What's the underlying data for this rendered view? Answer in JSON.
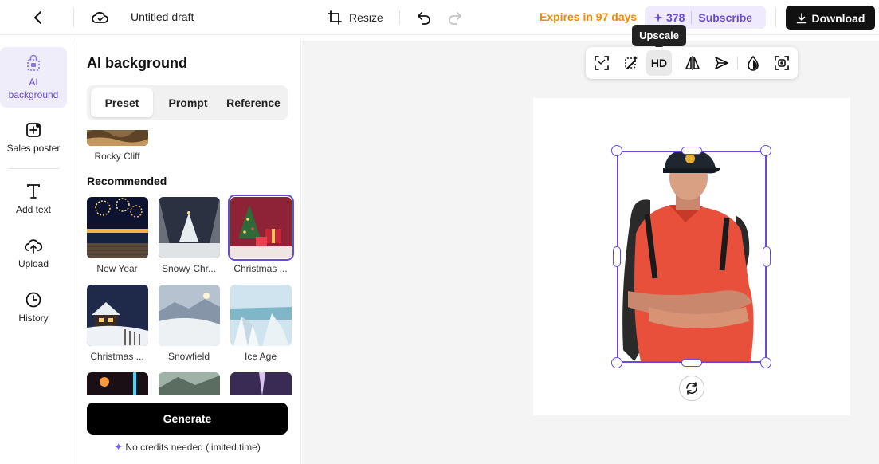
{
  "header": {
    "back_icon": "chevron-left-icon",
    "cloud_icon": "cloud-sync-icon",
    "title": "Untitled draft",
    "resize_label": "Resize",
    "undo_icon": "undo-icon",
    "redo_icon": "redo-icon",
    "expires": "Expires in 97 days",
    "credits": "378",
    "subscribe": "Subscribe",
    "download": "Download"
  },
  "rail": {
    "items": [
      {
        "label_line1": "AI",
        "label_line2": "background",
        "icon": "ai-background-icon",
        "active": true
      },
      {
        "label": "Sales poster",
        "icon": "sales-poster-icon"
      },
      {
        "label": "Add text",
        "icon": "text-icon"
      },
      {
        "label": "Upload",
        "icon": "upload-icon"
      },
      {
        "label": "History",
        "icon": "history-icon"
      }
    ]
  },
  "panel": {
    "title": "AI background",
    "tabs": [
      "Preset",
      "Prompt",
      "Reference"
    ],
    "active_tab": "Preset",
    "top_item": "Rocky Cliff",
    "section": "Recommended",
    "presets": [
      "New Year",
      "Snowy Chr...",
      "Christmas ...",
      "Christmas ...",
      "Snowfield",
      "Ice Age"
    ],
    "selected_preset": "Christmas ...",
    "generate": "Generate",
    "note": "No credits needed (limited time)"
  },
  "toolbar": {
    "tooltip": "Upscale",
    "hd_label": "HD",
    "tools": [
      "resize-frame-icon",
      "magic-erase-icon",
      "hd-upscale",
      "flip-icon",
      "send-icon",
      "drop-icon",
      "focus-icon"
    ]
  },
  "colors": {
    "accent": "#6b4ad9",
    "expires": "#f08a00",
    "download_bg": "#111111"
  }
}
